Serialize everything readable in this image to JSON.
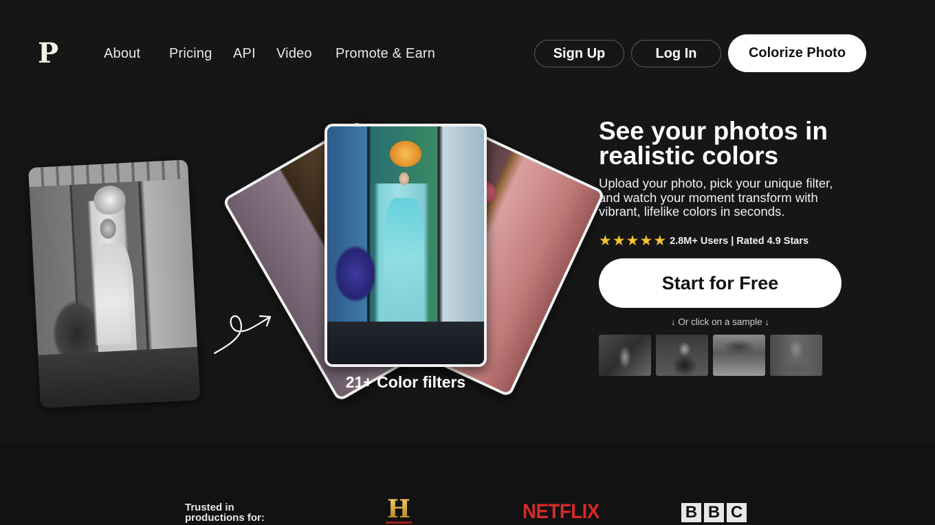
{
  "brand": {
    "logo_letter": "P"
  },
  "nav": {
    "links": [
      {
        "label": "About"
      },
      {
        "label": "Pricing"
      },
      {
        "label": "API"
      },
      {
        "label": "Video"
      },
      {
        "label": "Promote & Earn"
      }
    ],
    "sign_up_label": "Sign Up",
    "log_in_label": "Log In",
    "colorize_label": "Colorize Photo"
  },
  "showcase": {
    "filters_caption": "21+ Color filters",
    "cards": [
      "original-bw",
      "filter-gold",
      "filter-teal",
      "filter-rose"
    ]
  },
  "hero": {
    "title": "See your photos in realistic colors",
    "subtitle": "Upload your photo, pick your unique filter, and watch your moment transform with vibrant, lifelike colors in seconds.",
    "stars": 5,
    "stars_icon": "★",
    "rating_text": "2.8M+ Users | Rated 4.9 Stars",
    "cta_label": "Start for Free",
    "sample_hint": "↓ Or click on a sample ↓",
    "samples": [
      {
        "name": "sample-woman-garden"
      },
      {
        "name": "sample-man-desk"
      },
      {
        "name": "sample-garden-path"
      },
      {
        "name": "sample-mother-children"
      }
    ]
  },
  "trusted": {
    "label": "Trusted in productions for:",
    "logos": [
      {
        "name": "History",
        "glyph": "H"
      },
      {
        "name": "Netflix",
        "text": "NETFLIX"
      },
      {
        "name": "BBC",
        "letters": [
          "B",
          "B",
          "C"
        ]
      }
    ]
  },
  "colors": {
    "background": "#161616",
    "star": "#f6c232",
    "netflix_red": "#d72a2a",
    "history_gold": "#d6a63a"
  }
}
